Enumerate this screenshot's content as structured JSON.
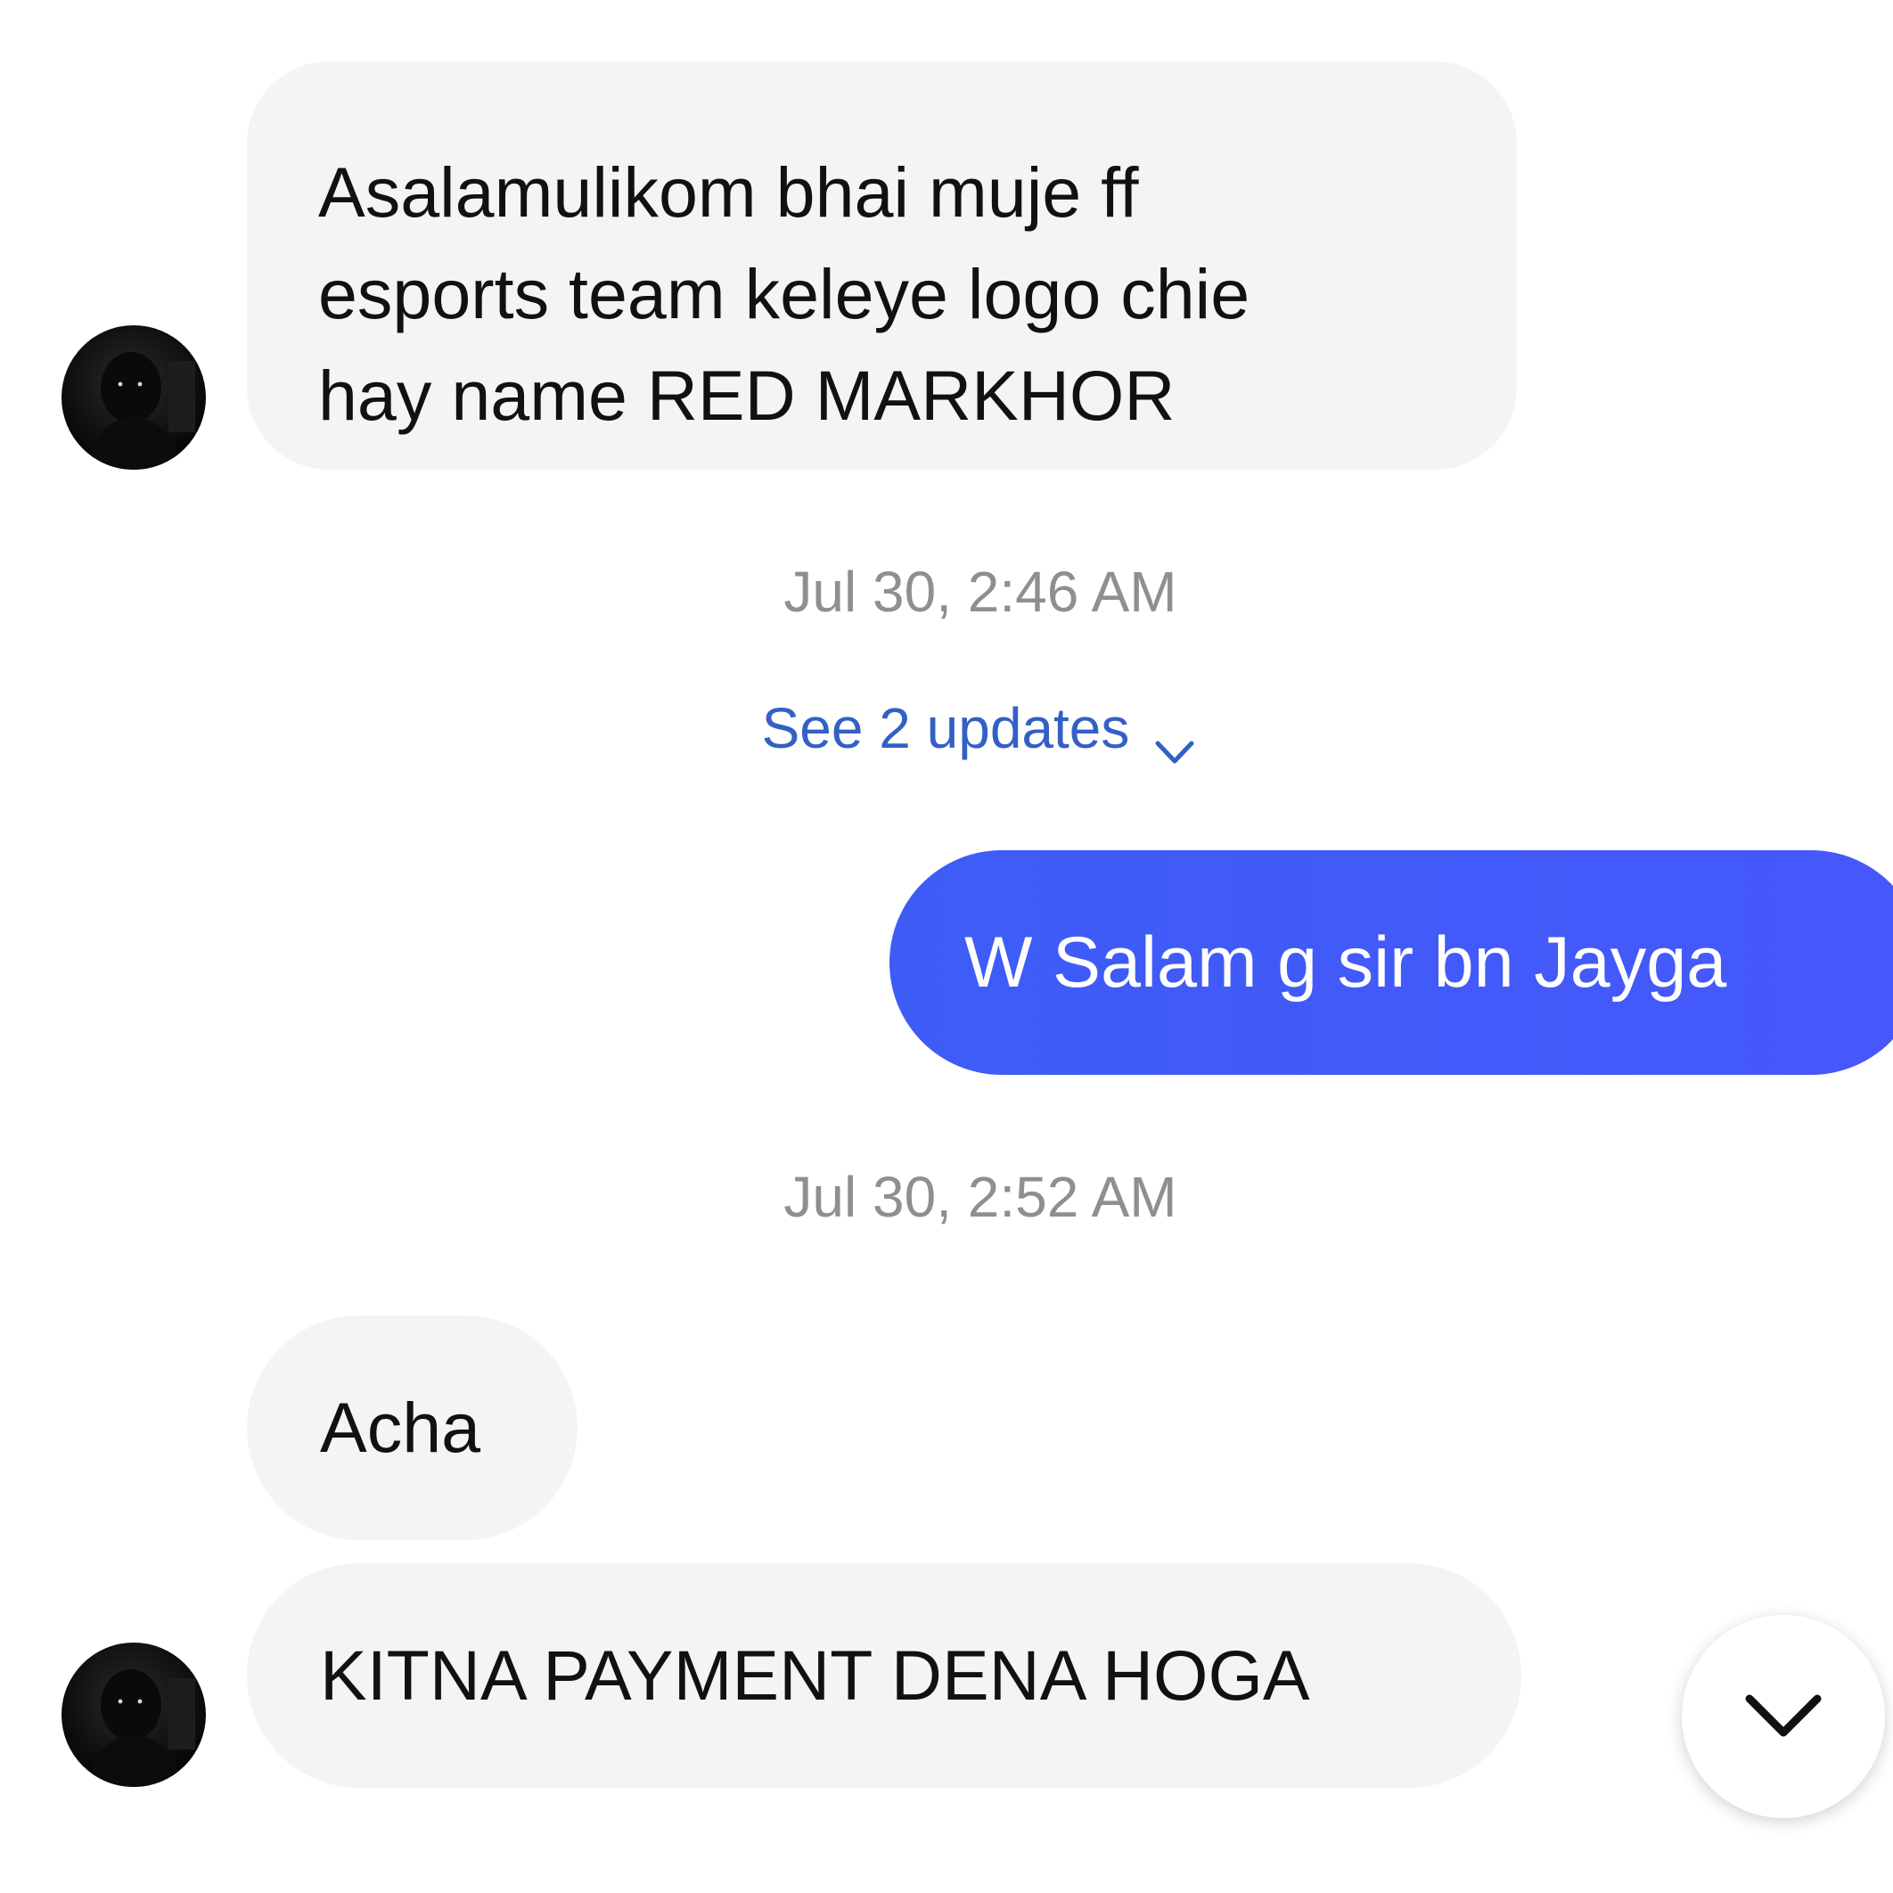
{
  "messages": [
    {
      "sender": "other",
      "text": "Asalamulikom bhai muje ff\nesports team keleye logo chie\nhay name RED MARKHOR"
    },
    {
      "sender": "me",
      "text": "W Salam g sir bn Jayga"
    },
    {
      "sender": "other",
      "text": "Acha"
    },
    {
      "sender": "other",
      "text": "KITNA PAYMENT DENA HOGA"
    }
  ],
  "timestamps": [
    "Jul 30, 2:46 AM",
    "Jul 30, 2:52 AM"
  ],
  "updates_link": {
    "label": "See 2 updates",
    "icon": "chevron-down-icon"
  },
  "scroll_button": {
    "icon": "chevron-down-icon"
  },
  "colors": {
    "incoming_bubble": "#f4f4f5",
    "outgoing_bubble": "#3d5cf6",
    "link": "#3360c4",
    "timestamp": "#8e8e93"
  }
}
